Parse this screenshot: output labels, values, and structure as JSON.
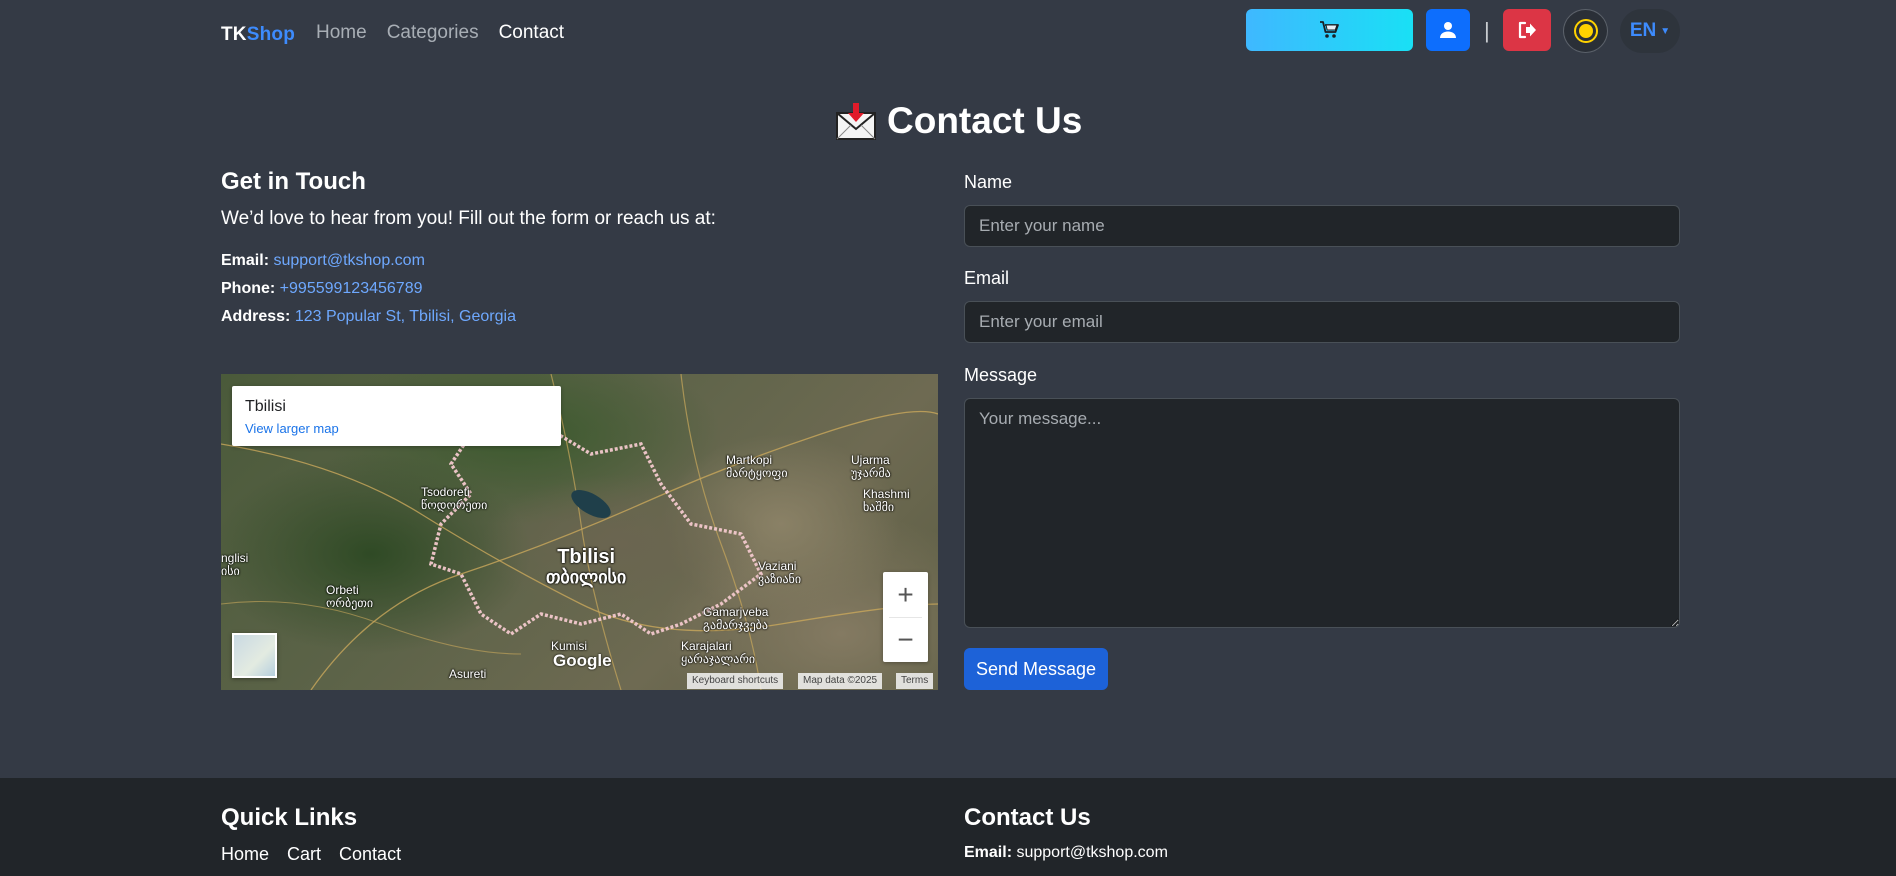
{
  "navbar": {
    "brand_tk": "TK",
    "brand_shop": "Shop",
    "links": [
      "Home",
      "Categories",
      "Contact"
    ],
    "active_link": "Contact",
    "separator": "|",
    "language": "EN",
    "icons": {
      "cart": "shopping-cart-icon",
      "user": "user-icon",
      "logout": "logout-icon",
      "theme": "sun-icon"
    }
  },
  "page": {
    "title": "Contact Us",
    "title_icon": "envelope-icon"
  },
  "touch": {
    "heading": "Get in Touch",
    "intro": "We’d love to hear from you! Fill out the form or reach us at:",
    "email_label": "Email:",
    "email_value": "support@tkshop.com",
    "phone_label": "Phone:",
    "phone_value": "+995599123456789",
    "address_label": "Address:",
    "address_value": "123 Popular St, Tbilisi, Georgia"
  },
  "map": {
    "place_name": "Tbilisi",
    "larger_map_link": "View larger map",
    "city_label_latin": "Tbilisi",
    "city_label_georgian": "თბილისი",
    "labels": [
      {
        "en": "Tsodoreti",
        "ka": "წოდორეთი"
      },
      {
        "en": "Martkopi",
        "ka": "მარტყოფი"
      },
      {
        "en": "Ujarma",
        "ka": "უჯარმა"
      },
      {
        "en": "Khashmi",
        "ka": "ხაშმი"
      },
      {
        "en": "Vaziani",
        "ka": "ვაზიანი"
      },
      {
        "en": "Orbeti",
        "ka": "ორბეთი"
      },
      {
        "en": "Gamarjveba",
        "ka": "გამარჯვება"
      },
      {
        "en": "Karajalari",
        "ka": "ყარაჯალარი"
      },
      {
        "en": "Kumisi",
        "ka": "კუმისი"
      },
      {
        "en": "Asureti",
        "ka": "ასურეთი"
      },
      {
        "en": "nglisi",
        "ka": "ისი"
      }
    ],
    "zoom_in": "+",
    "zoom_out": "−",
    "google": "Google",
    "keyboard_shortcuts": "Keyboard shortcuts",
    "map_data": "Map data ©2025",
    "terms": "Terms"
  },
  "form": {
    "name_label": "Name",
    "name_placeholder": "Enter your name",
    "email_label": "Email",
    "email_placeholder": "Enter your email",
    "message_label": "Message",
    "message_placeholder": "Your message...",
    "submit_label": "Send Message"
  },
  "footer": {
    "quick_links_title": "Quick Links",
    "quick_links": [
      "Home",
      "Cart",
      "Contact"
    ],
    "contact_title": "Contact Us",
    "email_label": "Email:",
    "email_value": "support@tkshop.com"
  },
  "colors": {
    "background": "#343a45",
    "footer": "#212529",
    "primary": "#0d6efd",
    "danger": "#dc3545",
    "link": "#6ea8fe",
    "cart_gradient_start": "#3fb8ff",
    "cart_gradient_end": "#19e0f5"
  }
}
